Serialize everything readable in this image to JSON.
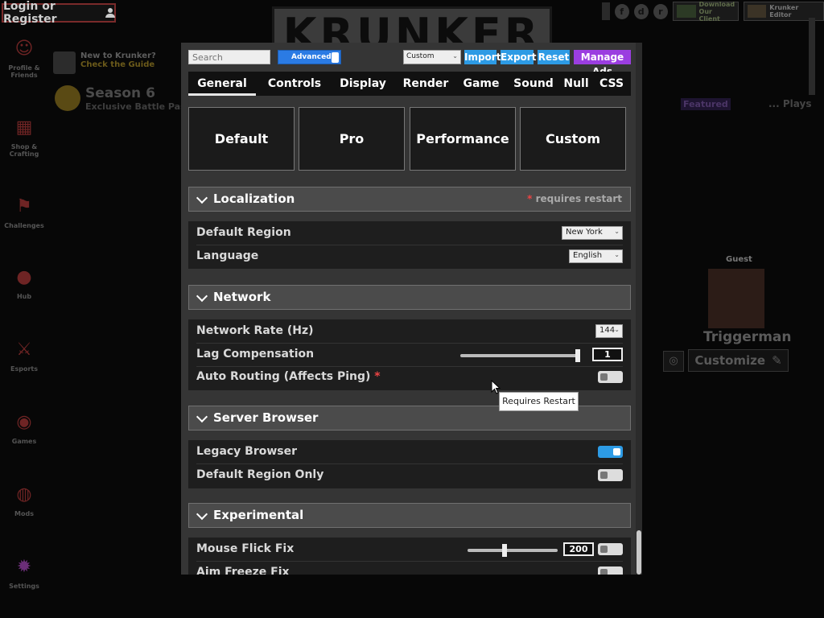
{
  "login": {
    "label": "Login or Register"
  },
  "logo": {
    "text": "KRUNKER"
  },
  "sidebar": {
    "items": [
      {
        "label": "Profile & Friends",
        "icon": "profile-icon"
      },
      {
        "label": "Shop & Crafting",
        "icon": "shop-icon"
      },
      {
        "label": "Challenges",
        "icon": "flag-icon"
      },
      {
        "label": "Hub",
        "icon": "globe-icon"
      },
      {
        "label": "Esports",
        "icon": "swords-icon"
      },
      {
        "label": "Games",
        "icon": "gamepad-icon"
      },
      {
        "label": "Mods",
        "icon": "palette-icon"
      },
      {
        "label": "Settings",
        "icon": "gear-icon"
      }
    ]
  },
  "guide": {
    "line1": "New to Krunker?",
    "line2": "Check the Guide"
  },
  "season": {
    "title": "Season 6",
    "subtitle": "Exclusive Battle Pass"
  },
  "topright": {
    "client_line1": "Download",
    "client_line2": "Our Client",
    "editor_line1": "Krunker Editor"
  },
  "lobby": {
    "featured": "Featured",
    "plays": "... Plays",
    "guest": "Guest",
    "player_name": "Triggerman",
    "customize": "Customize"
  },
  "settings": {
    "search_placeholder": "Search",
    "advanced_label": "Advanced",
    "preset_value": "Custom",
    "actions": {
      "import": "Import",
      "export": "Export",
      "reset": "Reset",
      "manage_ads": "Manage Ads"
    },
    "tabs": [
      "General",
      "Controls",
      "Display",
      "Render",
      "Game",
      "Sound",
      "Null",
      "CSS"
    ],
    "active_tab": "General",
    "presets": [
      "Default",
      "Pro",
      "Performance",
      "Custom"
    ],
    "sections": {
      "localization": {
        "title": "Localization",
        "note": "requires restart",
        "default_region": {
          "label": "Default Region",
          "value": "New York"
        },
        "language": {
          "label": "Language",
          "value": "English"
        }
      },
      "network": {
        "title": "Network",
        "network_rate": {
          "label": "Network Rate (Hz)",
          "value": "144"
        },
        "lag_compensation": {
          "label": "Lag Compensation",
          "value": "1",
          "slider_fraction": 1.0
        },
        "auto_routing": {
          "label": "Auto Routing (Affects Ping)",
          "enabled": false
        }
      },
      "server_browser": {
        "title": "Server Browser",
        "legacy_browser": {
          "label": "Legacy Browser",
          "enabled": true
        },
        "default_region_only": {
          "label": "Default Region Only",
          "enabled": false
        }
      },
      "experimental": {
        "title": "Experimental",
        "mouse_flick_fix": {
          "label": "Mouse Flick Fix",
          "value": "200",
          "slider_fraction": 0.4,
          "enabled": false
        },
        "aim_freeze_fix": {
          "label": "Aim Freeze Fix",
          "enabled": false
        }
      }
    },
    "tooltip": "Requires Restart"
  }
}
